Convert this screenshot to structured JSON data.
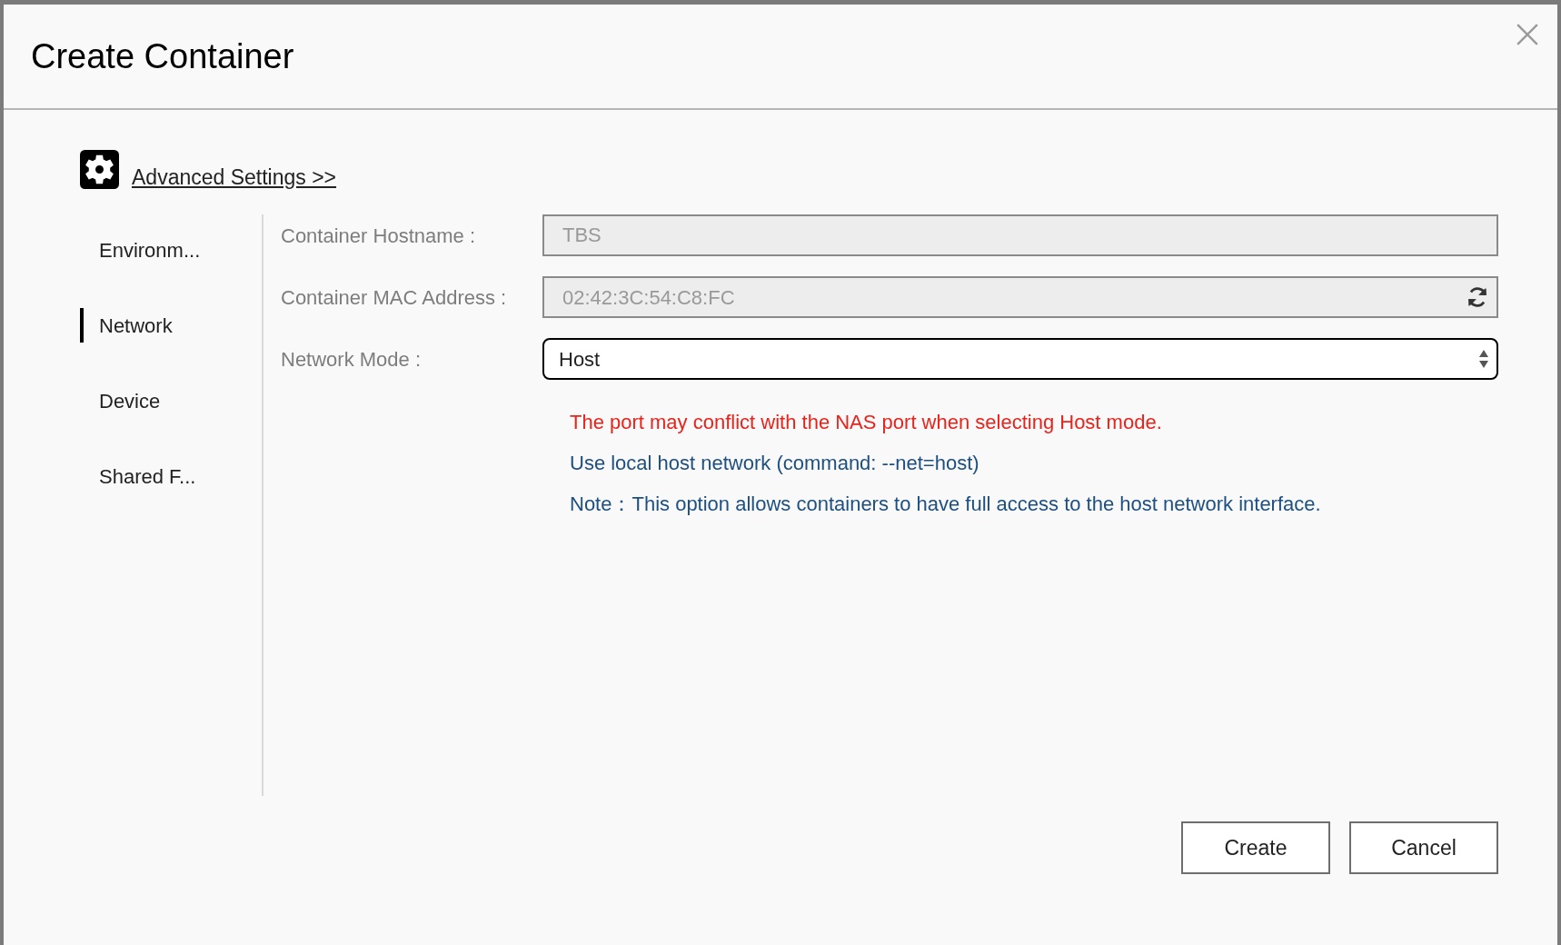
{
  "dialog": {
    "title": "Create Container"
  },
  "advanced_settings": {
    "label": "Advanced Settings >>"
  },
  "sidebar": {
    "items": [
      {
        "label": "Environm...",
        "selected": false
      },
      {
        "label": "Network",
        "selected": true
      },
      {
        "label": "Device",
        "selected": false
      },
      {
        "label": "Shared F...",
        "selected": false
      }
    ]
  },
  "fields": [
    {
      "kind": "text",
      "label": "Container Hostname :",
      "value": "TBS",
      "disabled": true
    },
    {
      "kind": "refresh",
      "label": "Container MAC Address :",
      "value": "02:42:3C:54:C8:FC",
      "disabled": true
    },
    {
      "kind": "select",
      "label": "Network Mode :",
      "value": "Host",
      "disabled": false
    }
  ],
  "messages": [
    {
      "kind": "warning",
      "text": "The port may conflict with the NAS port when selecting Host mode."
    },
    {
      "kind": "info",
      "text": "Use local host network (command: --net=host)"
    },
    {
      "kind": "info",
      "text": "Note：This option allows containers to have full access to the host network interface."
    }
  ],
  "buttons": [
    "Create",
    "Cancel"
  ]
}
